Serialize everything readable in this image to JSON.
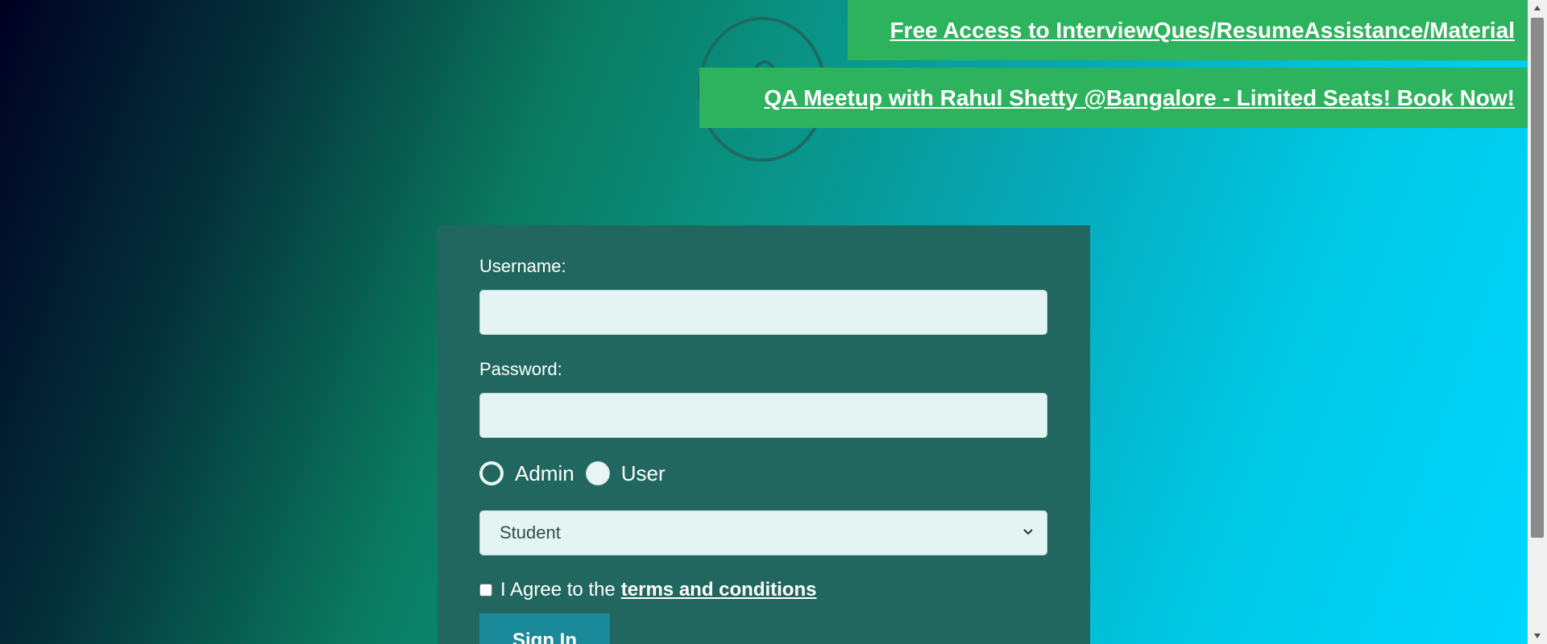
{
  "banners": {
    "top": "Free Access to InterviewQues/ResumeAssistance/Material",
    "second": "QA Meetup with Rahul Shetty @Bangalore - Limited Seats! Book Now!"
  },
  "form": {
    "username_label": "Username:",
    "username_value": "",
    "password_label": "Password:",
    "password_value": "",
    "radio_options": [
      "Admin",
      "User"
    ],
    "radio_selected": "Admin",
    "select_value": "Student",
    "checkbox_checked": false,
    "terms_prefix": "I Agree to the",
    "terms_link": "terms and conditions",
    "signin_label": "Sign In"
  },
  "icons": {
    "avatar": "user-avatar-icon",
    "select": "chevron-down-icon",
    "scroll_up": "triangle-up-icon",
    "scroll_down": "triangle-down-icon"
  },
  "colors": {
    "banner_bg": "#2db35d",
    "card_bg": "#216760",
    "input_bg": "#e4f4f2",
    "button_bg": "#1a8a9a"
  }
}
